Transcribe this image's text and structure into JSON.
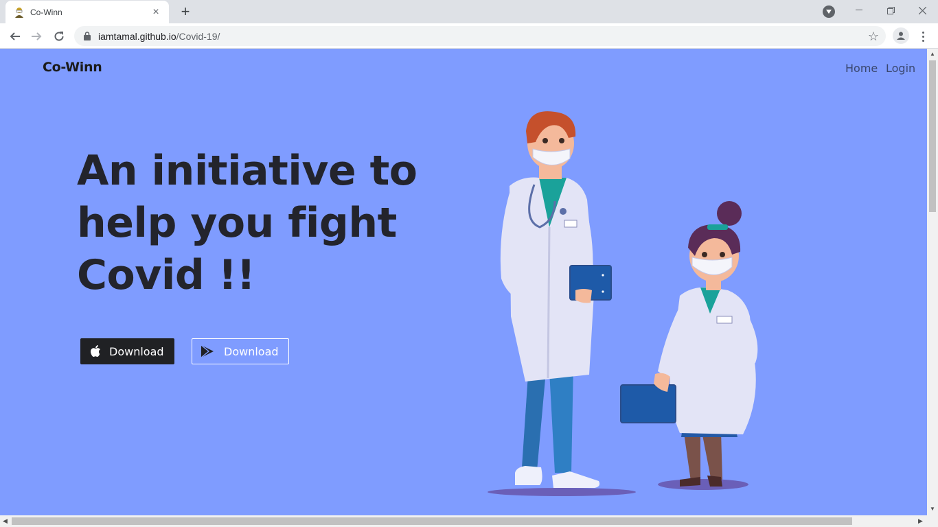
{
  "browser": {
    "tab_title": "Co-Winn",
    "tab_favicon": "face-mask-person-icon",
    "new_tab_label": "+",
    "url_host": "iamtamal.github.io",
    "url_path": "/Covid-19/",
    "icons": [
      "back-arrow-icon",
      "forward-arrow-icon",
      "reload-icon",
      "lock-icon",
      "star-icon",
      "account-icon",
      "kebab-menu-icon",
      "minimize-icon",
      "restore-icon",
      "close-icon"
    ]
  },
  "navbar": {
    "brand": "Co-Winn",
    "links": [
      {
        "label": "Home"
      },
      {
        "label": "Login"
      }
    ]
  },
  "hero": {
    "line1": "An initiative to",
    "line2": "help you fight",
    "line3": "Covid !!"
  },
  "buttons": {
    "apple_label": "Download",
    "play_label": "Download",
    "apple_icon": "apple-logo-icon",
    "play_icon": "google-play-icon"
  },
  "colors": {
    "page_bg": "#7f9cff",
    "heading": "#23242c",
    "apple_button_bg": "#202124",
    "nav_link": "#39466e"
  }
}
